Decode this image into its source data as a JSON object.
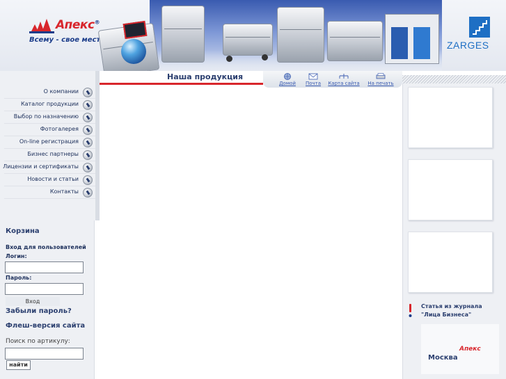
{
  "brand": {
    "name": "Апекс",
    "trademark": "®",
    "tagline": "Всему - свое место!",
    "partner": "ZARGES",
    "colors": {
      "brand_red": "#d8262c",
      "brand_blue": "#1b3c8a",
      "partner_blue": "#1e6fc4"
    }
  },
  "toolbar": {
    "section_title": "Наша продукция",
    "tools": [
      {
        "label": "Домой",
        "icon": "globe-icon"
      },
      {
        "label": "Почта",
        "icon": "envelope-icon"
      },
      {
        "label": "Карта сайта",
        "icon": "sitemap-icon"
      },
      {
        "label": "На печать",
        "icon": "printer-icon"
      }
    ]
  },
  "nav": {
    "items": [
      {
        "label": "О компании",
        "icon": "search-icon"
      },
      {
        "label": "Каталог продукции",
        "icon": "search-icon"
      },
      {
        "label": "Выбор по назначению",
        "icon": "search-icon"
      },
      {
        "label": "Фотогалерея",
        "icon": "search-icon"
      },
      {
        "label": "On-line регистрация",
        "icon": "search-icon"
      },
      {
        "label": "Бизнес партнеры",
        "icon": "search-icon"
      },
      {
        "label": "Лицензии и сертификаты",
        "icon": "search-icon"
      },
      {
        "label": "Новости и статьи",
        "icon": "search-icon"
      },
      {
        "label": "Контакты",
        "icon": "search-icon"
      }
    ]
  },
  "sidebar": {
    "cart_label": "Корзина",
    "login_heading": "Вход для пользователей",
    "login_label": "Логин:",
    "login_value": "",
    "password_label": "Пароль:",
    "password_value": "",
    "login_button": "Вход",
    "forgot_password": "Забыли пароль?",
    "flash_version": "Флеш-версия сайта",
    "search_label": "Поиск по артикулу:",
    "search_value": "",
    "search_button": "найти"
  },
  "right": {
    "article_line1": "Статья из журнала",
    "article_line2": "\"Лица Бизнеса\"",
    "city": "Москва",
    "city_logo": "Апекс"
  }
}
